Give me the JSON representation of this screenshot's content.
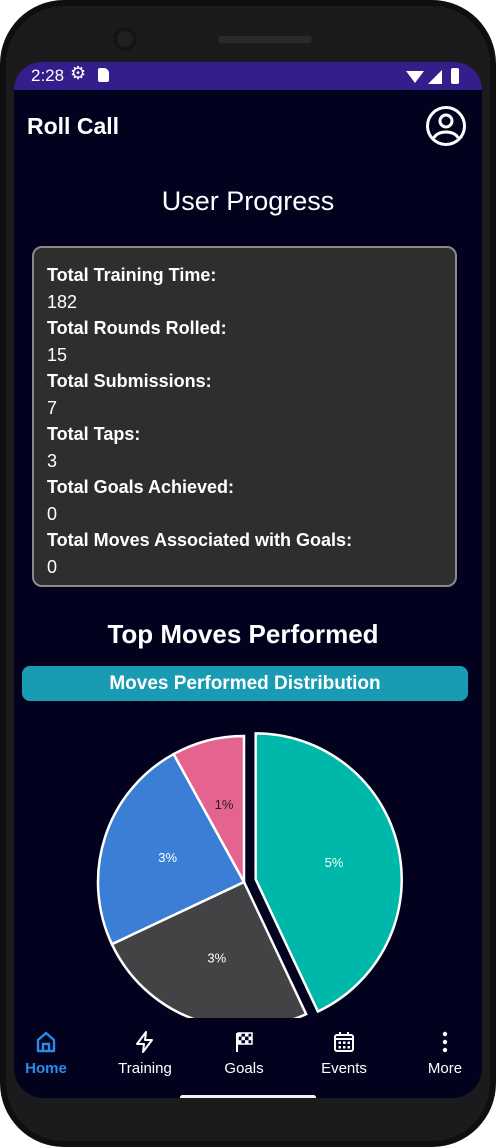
{
  "status_bar": {
    "time": "2:28"
  },
  "app_bar": {
    "title": "Roll Call"
  },
  "page": {
    "title": "User Progress"
  },
  "stats": [
    {
      "label": "Total Training Time:",
      "value": "182"
    },
    {
      "label": "Total Rounds Rolled:",
      "value": "15"
    },
    {
      "label": "Total Submissions:",
      "value": "7"
    },
    {
      "label": "Total Taps:",
      "value": "3"
    },
    {
      "label": "Total Goals Achieved:",
      "value": "0"
    },
    {
      "label": "Total Moves Associated with Goals:",
      "value": "0"
    }
  ],
  "top_moves": {
    "title": "Top Moves Performed",
    "banner": "Moves Performed Distribution"
  },
  "chart_data": {
    "type": "pie",
    "title": "Moves Performed Distribution",
    "slices": [
      {
        "label": "5%",
        "value": 43,
        "color": "#00b8a9"
      },
      {
        "label": "3%",
        "value": 25,
        "color": "#434345"
      },
      {
        "label": "3%",
        "value": 24,
        "color": "#3a7fd5"
      },
      {
        "label": "1%",
        "value": 8,
        "color": "#e5648f"
      }
    ]
  },
  "bottom_nav": {
    "items": [
      {
        "label": "Home",
        "icon": "home-icon",
        "active": true
      },
      {
        "label": "Training",
        "icon": "bolt-icon",
        "active": false
      },
      {
        "label": "Goals",
        "icon": "checkered-flag-icon",
        "active": false
      },
      {
        "label": "Events",
        "icon": "calendar-icon",
        "active": false
      },
      {
        "label": "More",
        "icon": "more-vertical-icon",
        "active": false
      }
    ],
    "active_color": "#2b8be6"
  }
}
